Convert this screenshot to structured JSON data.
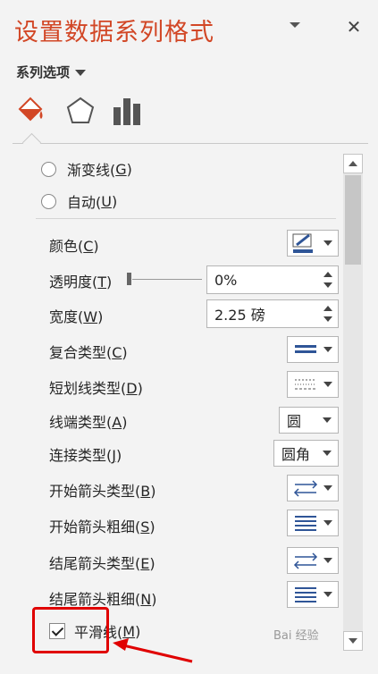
{
  "header": {
    "title": "设置数据系列格式",
    "close_label": "✕"
  },
  "options_menu": {
    "label": "系列选项"
  },
  "tabs": [
    {
      "name": "fill-line",
      "icon": "paint-bucket-icon"
    },
    {
      "name": "effects",
      "icon": "pentagon-icon"
    },
    {
      "name": "series-options",
      "icon": "bar-chart-icon"
    }
  ],
  "radios": [
    {
      "label": "渐变线(",
      "key": "G",
      "close": ")"
    },
    {
      "label": "自动(",
      "key": "U",
      "close": ")"
    }
  ],
  "props": {
    "color": {
      "label": "颜色(",
      "key": "C",
      "close": ")"
    },
    "transparency": {
      "label": "透明度(",
      "key": "T",
      "close": ")",
      "value": "0%"
    },
    "width": {
      "label": "宽度(",
      "key": "W",
      "close": ")",
      "value": "2.25 磅"
    },
    "compound": {
      "label": "复合类型(",
      "key": "C",
      "close": ")"
    },
    "dash": {
      "label": "短划线类型(",
      "key": "D",
      "close": ")"
    },
    "cap": {
      "label": "线端类型(",
      "key": "A",
      "close": ")",
      "value": "圆"
    },
    "join": {
      "label": "连接类型(",
      "key": "J",
      "close": ")",
      "value": "圆角"
    },
    "begin_arrow_type": {
      "label": "开始箭头类型(",
      "key": "B",
      "close": ")"
    },
    "begin_arrow_size": {
      "label": "开始箭头粗细(",
      "key": "S",
      "close": ")"
    },
    "end_arrow_type": {
      "label": "结尾箭头类型(",
      "key": "E",
      "close": ")"
    },
    "end_arrow_size": {
      "label": "结尾箭头粗细(",
      "key": "N",
      "close": ")"
    }
  },
  "smooth": {
    "label": "平滑线(",
    "key": "M",
    "close": ")",
    "checked": true
  },
  "watermark": "Bai 经验",
  "colors": {
    "title": "#d24726",
    "accent_line": "#2f5597",
    "highlight": "#e00000"
  }
}
